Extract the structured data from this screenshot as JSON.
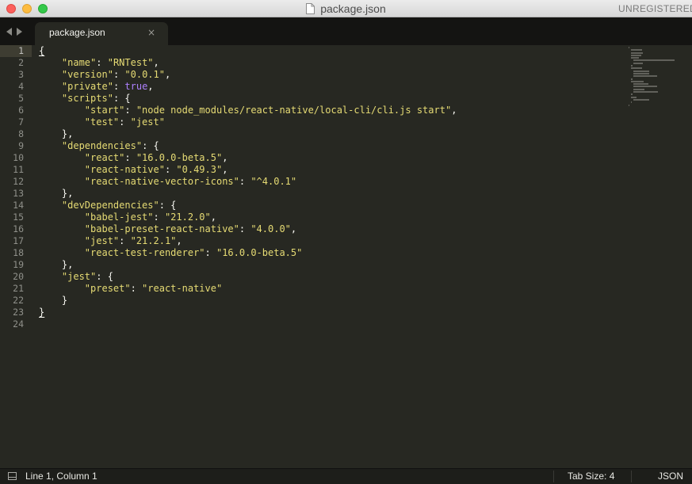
{
  "window": {
    "title": "package.json",
    "unregistered_label": "UNREGISTERED"
  },
  "tabs": [
    {
      "label": "package.json",
      "close": "×"
    }
  ],
  "editor": {
    "line_numbers": [
      "1",
      "2",
      "3",
      "4",
      "5",
      "6",
      "7",
      "8",
      "9",
      "10",
      "11",
      "12",
      "13",
      "14",
      "15",
      "16",
      "17",
      "18",
      "19",
      "20",
      "21",
      "22",
      "23",
      "24"
    ],
    "active_line": 1,
    "lines": [
      [
        {
          "t": "p",
          "v": "{"
        }
      ],
      [
        {
          "t": "p",
          "v": "    "
        },
        {
          "t": "s",
          "v": "\"name\""
        },
        {
          "t": "p",
          "v": ": "
        },
        {
          "t": "s",
          "v": "\"RNTest\""
        },
        {
          "t": "p",
          "v": ","
        }
      ],
      [
        {
          "t": "p",
          "v": "    "
        },
        {
          "t": "s",
          "v": "\"version\""
        },
        {
          "t": "p",
          "v": ": "
        },
        {
          "t": "s",
          "v": "\"0.0.1\""
        },
        {
          "t": "p",
          "v": ","
        }
      ],
      [
        {
          "t": "p",
          "v": "    "
        },
        {
          "t": "s",
          "v": "\"private\""
        },
        {
          "t": "p",
          "v": ": "
        },
        {
          "t": "k",
          "v": "true"
        },
        {
          "t": "p",
          "v": ","
        }
      ],
      [
        {
          "t": "p",
          "v": "    "
        },
        {
          "t": "s",
          "v": "\"scripts\""
        },
        {
          "t": "p",
          "v": ": {"
        }
      ],
      [
        {
          "t": "p",
          "v": "        "
        },
        {
          "t": "s",
          "v": "\"start\""
        },
        {
          "t": "p",
          "v": ": "
        },
        {
          "t": "s",
          "v": "\"node node_modules/react-native/local-cli/cli.js start\""
        },
        {
          "t": "p",
          "v": ","
        }
      ],
      [
        {
          "t": "p",
          "v": "        "
        },
        {
          "t": "s",
          "v": "\"test\""
        },
        {
          "t": "p",
          "v": ": "
        },
        {
          "t": "s",
          "v": "\"jest\""
        }
      ],
      [
        {
          "t": "p",
          "v": "    },"
        }
      ],
      [
        {
          "t": "p",
          "v": "    "
        },
        {
          "t": "s",
          "v": "\"dependencies\""
        },
        {
          "t": "p",
          "v": ": {"
        }
      ],
      [
        {
          "t": "p",
          "v": "        "
        },
        {
          "t": "s",
          "v": "\"react\""
        },
        {
          "t": "p",
          "v": ": "
        },
        {
          "t": "s",
          "v": "\"16.0.0-beta.5\""
        },
        {
          "t": "p",
          "v": ","
        }
      ],
      [
        {
          "t": "p",
          "v": "        "
        },
        {
          "t": "s",
          "v": "\"react-native\""
        },
        {
          "t": "p",
          "v": ": "
        },
        {
          "t": "s",
          "v": "\"0.49.3\""
        },
        {
          "t": "p",
          "v": ","
        }
      ],
      [
        {
          "t": "p",
          "v": "        "
        },
        {
          "t": "s",
          "v": "\"react-native-vector-icons\""
        },
        {
          "t": "p",
          "v": ": "
        },
        {
          "t": "s",
          "v": "\"^4.0.1\""
        }
      ],
      [
        {
          "t": "p",
          "v": "    },"
        }
      ],
      [
        {
          "t": "p",
          "v": "    "
        },
        {
          "t": "s",
          "v": "\"devDependencies\""
        },
        {
          "t": "p",
          "v": ": {"
        }
      ],
      [
        {
          "t": "p",
          "v": "        "
        },
        {
          "t": "s",
          "v": "\"babel-jest\""
        },
        {
          "t": "p",
          "v": ": "
        },
        {
          "t": "s",
          "v": "\"21.2.0\""
        },
        {
          "t": "p",
          "v": ","
        }
      ],
      [
        {
          "t": "p",
          "v": "        "
        },
        {
          "t": "s",
          "v": "\"babel-preset-react-native\""
        },
        {
          "t": "p",
          "v": ": "
        },
        {
          "t": "s",
          "v": "\"4.0.0\""
        },
        {
          "t": "p",
          "v": ","
        }
      ],
      [
        {
          "t": "p",
          "v": "        "
        },
        {
          "t": "s",
          "v": "\"jest\""
        },
        {
          "t": "p",
          "v": ": "
        },
        {
          "t": "s",
          "v": "\"21.2.1\""
        },
        {
          "t": "p",
          "v": ","
        }
      ],
      [
        {
          "t": "p",
          "v": "        "
        },
        {
          "t": "s",
          "v": "\"react-test-renderer\""
        },
        {
          "t": "p",
          "v": ": "
        },
        {
          "t": "s",
          "v": "\"16.0.0-beta.5\""
        }
      ],
      [
        {
          "t": "p",
          "v": "    },"
        }
      ],
      [
        {
          "t": "p",
          "v": "    "
        },
        {
          "t": "s",
          "v": "\"jest\""
        },
        {
          "t": "p",
          "v": ": {"
        }
      ],
      [
        {
          "t": "p",
          "v": "        "
        },
        {
          "t": "s",
          "v": "\"preset\""
        },
        {
          "t": "p",
          "v": ": "
        },
        {
          "t": "s",
          "v": "\"react-native\""
        }
      ],
      [
        {
          "t": "p",
          "v": "    }"
        }
      ],
      [
        {
          "t": "p",
          "v": "}"
        }
      ],
      []
    ]
  },
  "statusbar": {
    "position": "Line 1, Column 1",
    "tab_size": "Tab Size: 4",
    "syntax": "JSON"
  },
  "colors": {
    "background": "#272822",
    "string": "#e6db74",
    "constant": "#ae81ff",
    "plain": "#f8f8f2"
  }
}
